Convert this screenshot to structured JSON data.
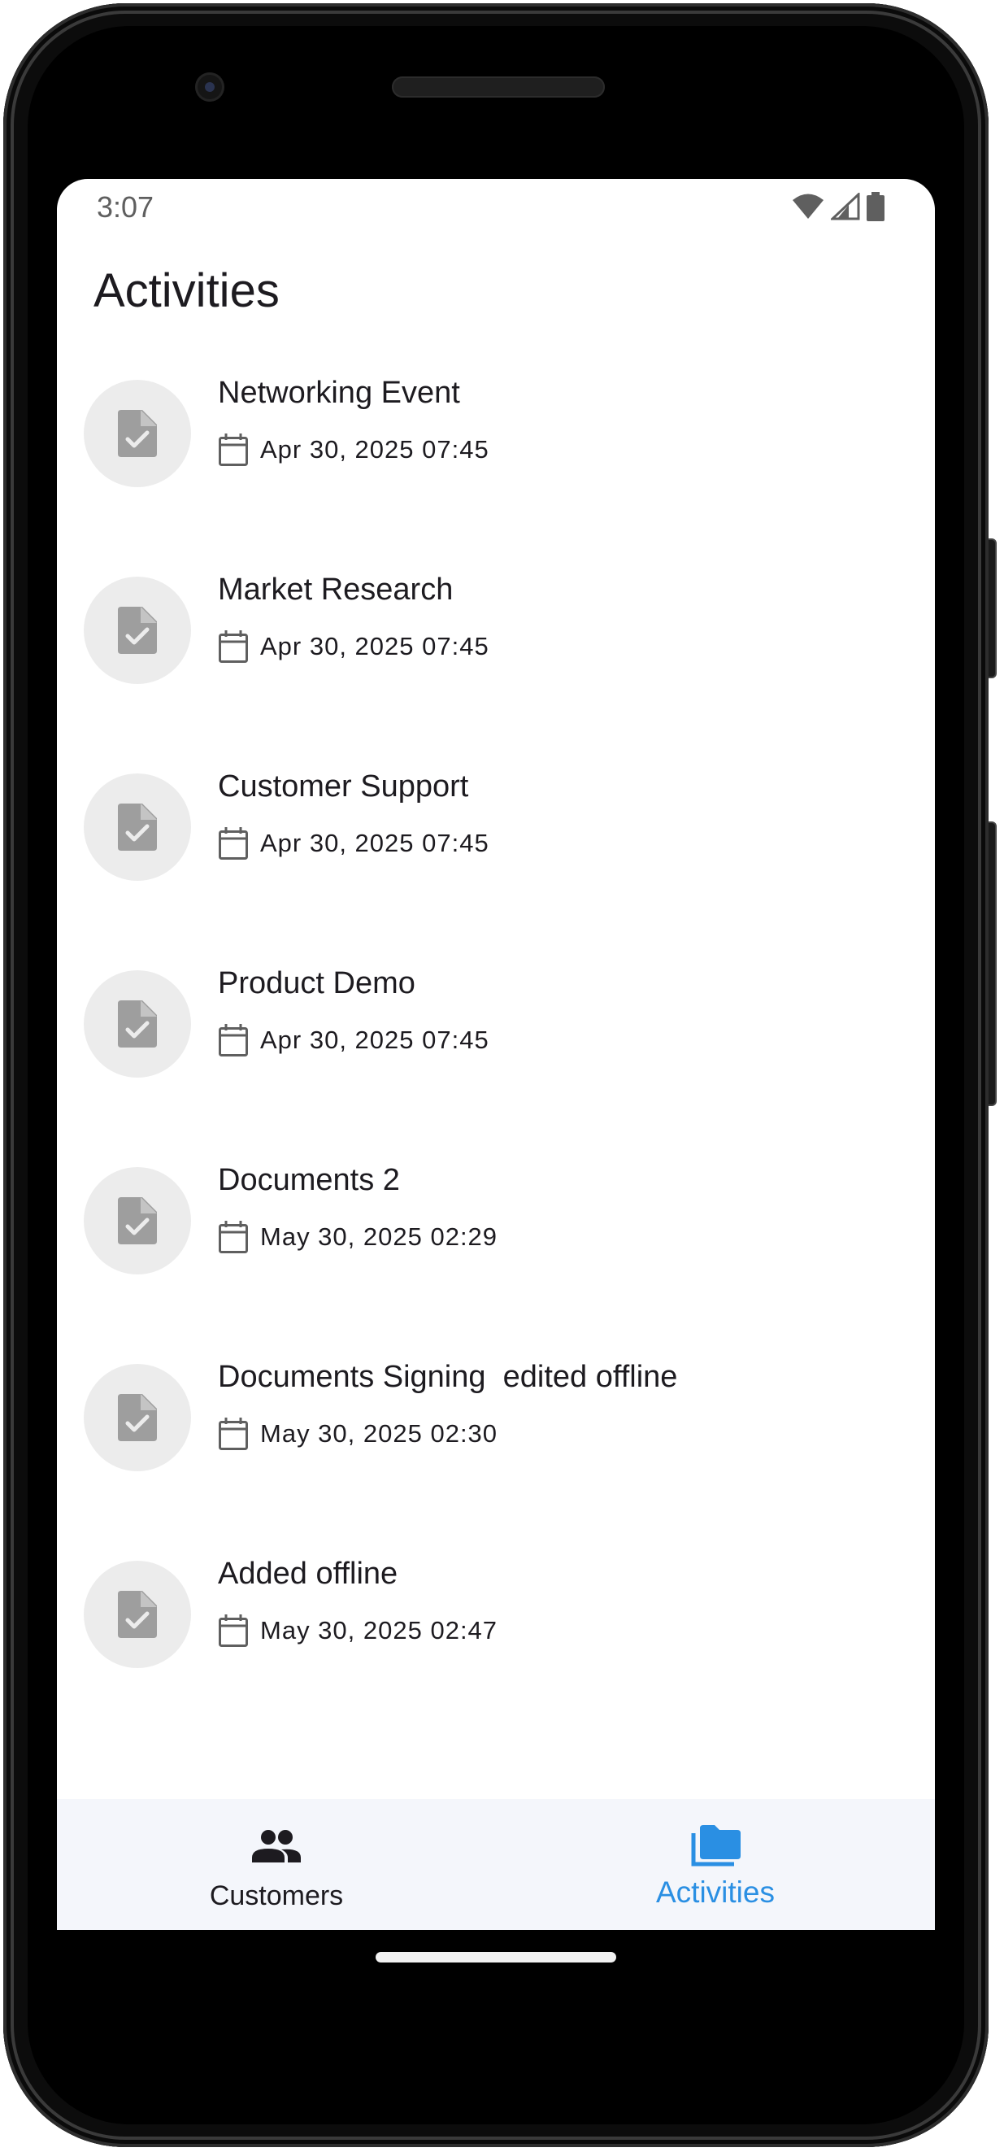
{
  "status_bar": {
    "time": "3:07"
  },
  "page": {
    "title": "Activities"
  },
  "activities": [
    {
      "title": "Networking Event",
      "date": "Apr 30, 2025 07:45"
    },
    {
      "title": "Market Research",
      "date": "Apr 30, 2025 07:45"
    },
    {
      "title": "Customer Support",
      "date": "Apr 30, 2025 07:45"
    },
    {
      "title": "Product Demo",
      "date": "Apr 30, 2025 07:45"
    },
    {
      "title": "Documents 2",
      "date": "May 30, 2025 02:29"
    },
    {
      "title": "Documents Signing  edited offline",
      "date": "May 30, 2025 02:30"
    },
    {
      "title": "Added offline",
      "date": "May 30, 2025 02:47"
    }
  ],
  "nav": {
    "items": [
      {
        "label": "Customers",
        "icon": "people-icon",
        "active": false
      },
      {
        "label": "Activities",
        "icon": "folder-icon",
        "active": true
      }
    ]
  },
  "colors": {
    "accent": "#2a8fe3",
    "nav_background": "#f4f6fb",
    "avatar_background": "#ececec",
    "icon_gray": "#9e9e9e"
  }
}
